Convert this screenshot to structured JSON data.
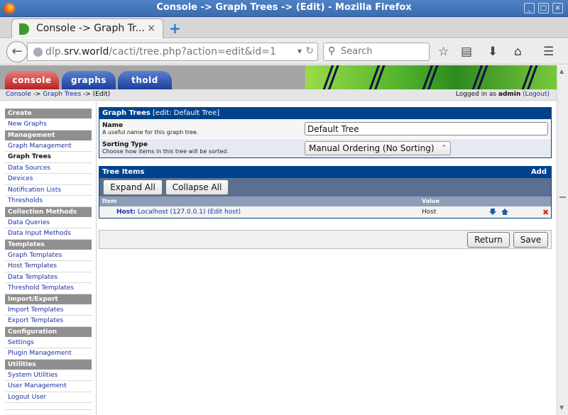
{
  "window": {
    "title": "Console -> Graph Trees -> (Edit) - Mozilla Firefox",
    "controls": [
      "_",
      "□",
      "×"
    ]
  },
  "browser": {
    "tab_title": "Console -> Graph Tr...",
    "tab_close": "×",
    "new_tab": "+",
    "url_prefix": "dlp.",
    "url_domain": "srv.world",
    "url_path": "/cacti/tree.php?action=edit&id=1",
    "search_placeholder": "Search"
  },
  "cacti": {
    "tabs": [
      "console",
      "graphs",
      "thold"
    ],
    "breadcrumb": {
      "console": "Console",
      "sep1": " -> ",
      "graph_trees": "Graph Trees",
      "sep2": " -> ",
      "edit": "(Edit)"
    },
    "login": {
      "prefix": "Logged in as ",
      "user": "admin",
      "logout": "(Logout)"
    }
  },
  "menu": {
    "sections": [
      {
        "title": "Create",
        "items": [
          "New Graphs"
        ]
      },
      {
        "title": "Management",
        "items": [
          "Graph Management",
          "Graph Trees",
          "Data Sources",
          "Devices",
          "Notification Lists",
          "Thresholds"
        ]
      },
      {
        "title": "Collection Methods",
        "items": [
          "Data Queries",
          "Data Input Methods"
        ]
      },
      {
        "title": "Templates",
        "items": [
          "Graph Templates",
          "Host Templates",
          "Data Templates",
          "Threshold Templates"
        ]
      },
      {
        "title": "Import/Export",
        "items": [
          "Import Templates",
          "Export Templates"
        ]
      },
      {
        "title": "Configuration",
        "items": [
          "Settings",
          "Plugin Management"
        ]
      },
      {
        "title": "Utilities",
        "items": [
          "System Utilities",
          "User Management",
          "Logout User"
        ]
      }
    ],
    "active": "Graph Trees"
  },
  "graph_tree_form": {
    "header_title": "Graph Trees",
    "header_sub": "[edit: Default Tree]",
    "name_label": "Name",
    "name_desc": "A useful name for this graph tree.",
    "name_value": "Default Tree",
    "sort_label": "Sorting Type",
    "sort_desc": "Choose how items in this tree will be sorted.",
    "sort_value": "Manual Ordering (No Sorting)"
  },
  "tree_items": {
    "header_title": "Tree Items",
    "add_label": "Add",
    "expand_all": "Expand All",
    "collapse_all": "Collapse All",
    "col_item": "Item",
    "col_value": "Value",
    "rows": [
      {
        "type_label": "Host:",
        "item_text": "Localhost (127.0.0.1) (Edit host)",
        "value": "Host"
      }
    ]
  },
  "actions": {
    "return_label": "Return",
    "save_label": "Save"
  },
  "colors": {
    "header_blue": "#00438c",
    "link_blue": "#1a2fa3",
    "console_tab_red": "#b82222",
    "delete_red": "#d2301a"
  }
}
